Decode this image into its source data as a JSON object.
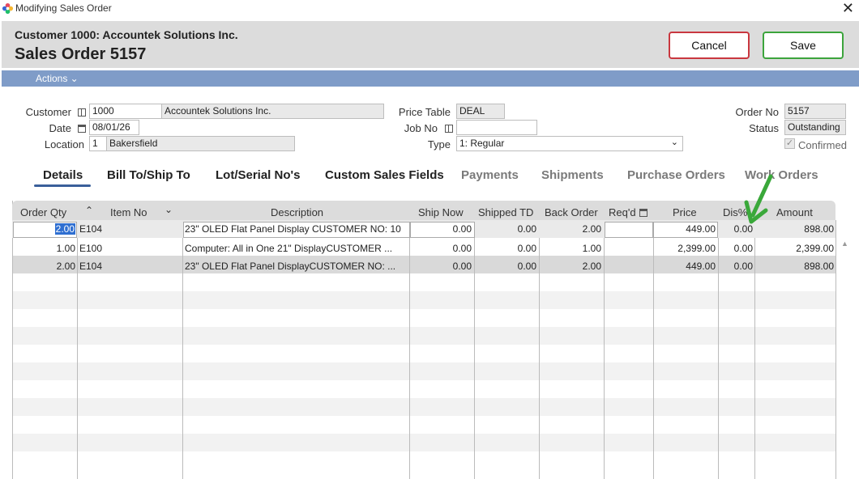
{
  "window": {
    "title": "Modifying Sales Order",
    "close_glyph": "✕"
  },
  "header": {
    "customer_line": "Customer 1000: Accountek Solutions Inc.",
    "order_title": "Sales Order 5157",
    "cancel_label": "Cancel",
    "save_label": "Save"
  },
  "actionbar": {
    "actions_label": "Actions ⌄"
  },
  "form": {
    "customer_label": "Customer",
    "customer_no": "1000",
    "customer_name": "Accountek Solutions Inc.",
    "date_label": "Date",
    "date_value": "08/01/26",
    "location_label": "Location",
    "location_no": "1",
    "location_name": "Bakersfield",
    "price_table_label": "Price Table",
    "price_table_value": "DEAL",
    "job_no_label": "Job No",
    "job_no_value": "",
    "type_label": "Type",
    "type_value": "1: Regular",
    "order_no_label": "Order No",
    "order_no_value": "5157",
    "status_label": "Status",
    "status_value": "Outstanding",
    "confirmed_label": "Confirmed",
    "confirmed_checked": true
  },
  "tabs": [
    {
      "label": "Details"
    },
    {
      "label": "Bill To/Ship To"
    },
    {
      "label": "Lot/Serial No's"
    },
    {
      "label": "Custom Sales Fields"
    },
    {
      "label": "Payments"
    },
    {
      "label": "Shipments"
    },
    {
      "label": "Purchase Orders"
    },
    {
      "label": "Work Orders"
    }
  ],
  "grid": {
    "columns": [
      "Order Qty",
      "Item No",
      "Description",
      "Ship Now",
      "Shipped TD",
      "Back Order",
      "Req'd",
      "Price",
      "Dis%",
      "Amount"
    ],
    "edit_row": {
      "order_qty": "2.00",
      "item_no": "E104",
      "description": "23\" OLED Flat Panel Display CUSTOMER NO: 10",
      "ship_now": "0.00",
      "shipped_td": "0.00",
      "back_order": "2.00",
      "reqd": "",
      "price": "449.00",
      "dis": "0.00",
      "amount": "898.00"
    },
    "rows": [
      {
        "order_qty": "1.00",
        "item_no": "E100",
        "description": "Computer: All in One 21\" DisplayCUSTOMER ...",
        "ship_now": "0.00",
        "shipped_td": "0.00",
        "back_order": "1.00",
        "reqd": "",
        "price": "2,399.00",
        "dis": "0.00",
        "amount": "2,399.00"
      },
      {
        "order_qty": "2.00",
        "item_no": "E104",
        "description": "23\" OLED Flat Panel DisplayCUSTOMER NO: ...",
        "ship_now": "0.00",
        "shipped_td": "0.00",
        "back_order": "2.00",
        "reqd": "",
        "price": "449.00",
        "dis": "0.00",
        "amount": "898.00"
      }
    ]
  },
  "colors": {
    "accent_bar": "#7f9cc8",
    "cancel_border": "#c9373f",
    "save_border": "#3ca43c",
    "arrow": "#3aa83a"
  }
}
